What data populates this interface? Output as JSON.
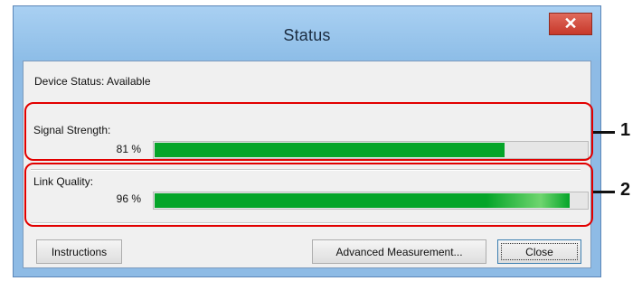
{
  "window": {
    "title": "Status",
    "close_glyph": "✕"
  },
  "device_status": {
    "text": "Device Status: Available"
  },
  "signal_strength": {
    "label": "Signal Strength:",
    "percent_text": "81 %",
    "value": 0.81
  },
  "link_quality": {
    "label": "Link Quality:",
    "percent_text": "96 %",
    "value": 0.96
  },
  "buttons": {
    "instructions": "Instructions",
    "advanced_measurement": "Advanced Measurement...",
    "close": "Close"
  },
  "callouts": [
    "1",
    "2"
  ],
  "colors": {
    "bar_fill": "#05a529",
    "callout_border": "#e20000",
    "close_button": "#c7382a"
  }
}
